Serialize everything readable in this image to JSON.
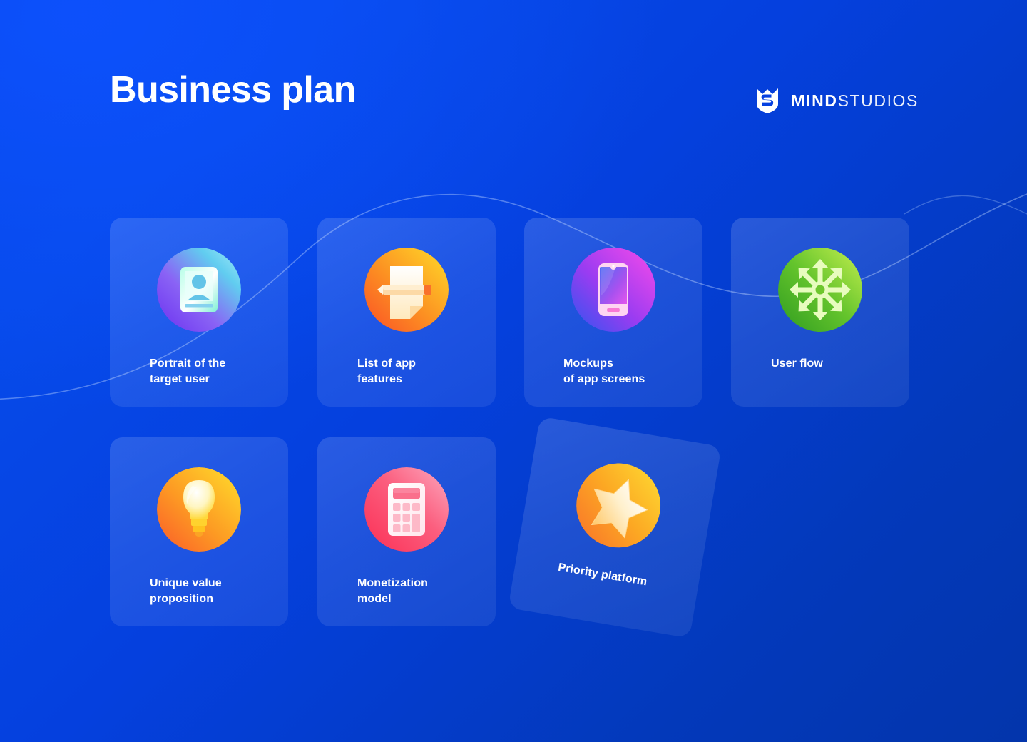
{
  "header": {
    "title": "Business plan",
    "logo": {
      "mark_name": "mindstudios-shield-logo",
      "word_primary": "MIND",
      "word_secondary": "STUDIOS"
    }
  },
  "theme": {
    "background_top_left": "#0747e8",
    "background_bottom_right": "#0335ab",
    "card_fill": "rgba(255,255,255,0.12)",
    "text_color": "#ffffff"
  },
  "cards": [
    {
      "id": "portrait-of-the-target-user",
      "label": "Portrait of the\ntarget user",
      "icon": "id-card-profile-icon",
      "icon_colors": [
        "#7b3ff2",
        "#8f5cf7",
        "#6fd6f0",
        "#9be8f5"
      ]
    },
    {
      "id": "list-of-app-features",
      "label": "List of app\nfeatures",
      "icon": "document-pencil-icon",
      "icon_colors": [
        "#fb5d2a",
        "#fb9223",
        "#fdd119",
        "#ffe14d"
      ]
    },
    {
      "id": "mockups-of-app-screens",
      "label": "Mockups\nof app screens",
      "icon": "smartphone-icon",
      "icon_colors": [
        "#3a5df0",
        "#8c3df0",
        "#e23df0",
        "#f549e8"
      ]
    },
    {
      "id": "user-flow",
      "label": "User flow",
      "icon": "radial-arrows-flow-icon",
      "icon_colors": [
        "#3fae24",
        "#63c62c",
        "#9ede3a",
        "#c4ee4e"
      ]
    },
    {
      "id": "unique-value-proposition",
      "label": "Unique value\nproposition",
      "icon": "lightbulb-icon",
      "icon_colors": [
        "#fa6a2c",
        "#fc9a24",
        "#fdd21c",
        "#ffef8a"
      ]
    },
    {
      "id": "monetization-model",
      "label": "Monetization\nmodel",
      "icon": "calculator-icon",
      "icon_colors": [
        "#fb3a5c",
        "#fb5775",
        "#fb7f9e",
        "#fda7bd"
      ]
    },
    {
      "id": "priority-platform",
      "label": "Priority platform",
      "icon": "star-icon",
      "icon_colors": [
        "#f97a2a",
        "#fb9c23",
        "#fdc71b",
        "#fee04a"
      ],
      "rotated": "9.5deg"
    }
  ]
}
